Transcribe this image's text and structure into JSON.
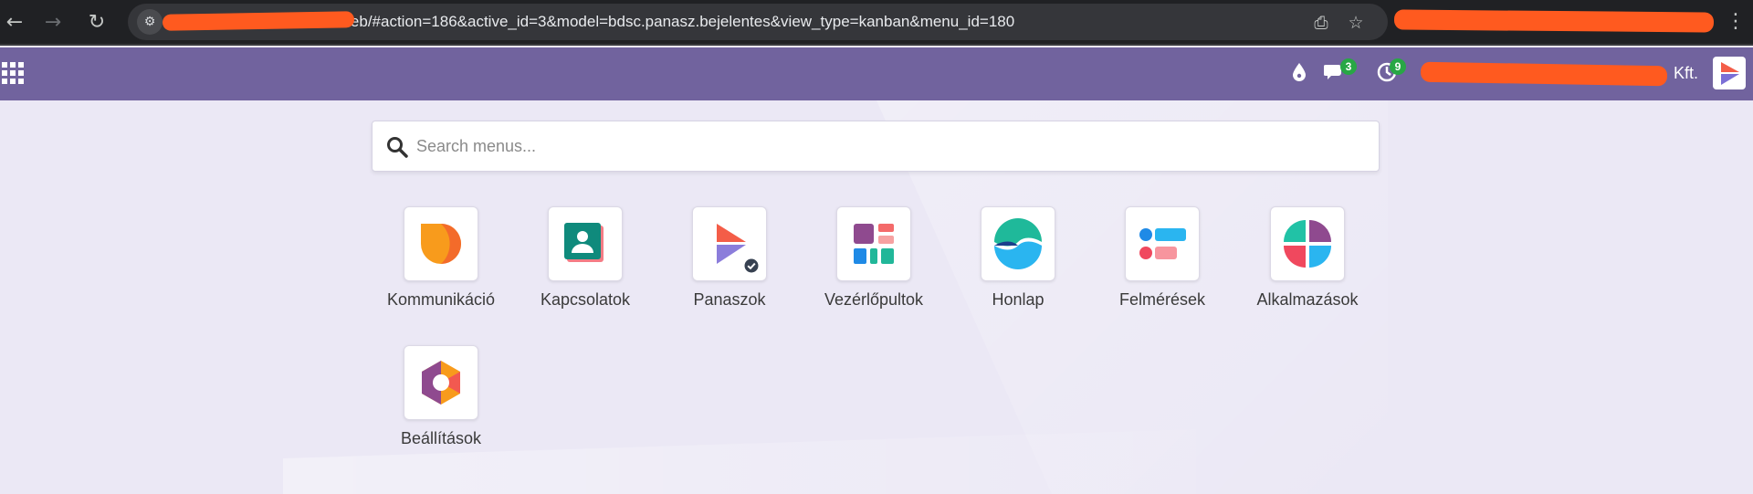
{
  "browser": {
    "url": "hu/web/#action=186&active_id=3&model=bdsc.panasz.bejelentes&view_type=kanban&menu_id=180",
    "back_icon": "arrow-left",
    "forward_icon": "arrow-right",
    "reload_icon": "reload",
    "site_info_icon": "tune",
    "install_icon": "install-app",
    "bookmark_icon": "star",
    "menu_icon": "vertical-dots"
  },
  "topbar": {
    "background": "#71639e",
    "chat_badge": "3",
    "activity_badge": "9",
    "company_name": "Kft."
  },
  "search": {
    "placeholder": "Search menus..."
  },
  "apps": [
    {
      "label": "Kommunikáció",
      "icon": "discuss-icon"
    },
    {
      "label": "Kapcsolatok",
      "icon": "contacts-icon"
    },
    {
      "label": "Panaszok",
      "icon": "panaszok-icon"
    },
    {
      "label": "Vezérlőpultok",
      "icon": "dashboards-icon"
    },
    {
      "label": "Honlap",
      "icon": "website-icon"
    },
    {
      "label": "Felmérések",
      "icon": "surveys-icon"
    },
    {
      "label": "Alkalmazások",
      "icon": "apps-icon"
    },
    {
      "label": "Beállítások",
      "icon": "settings-icon"
    }
  ]
}
